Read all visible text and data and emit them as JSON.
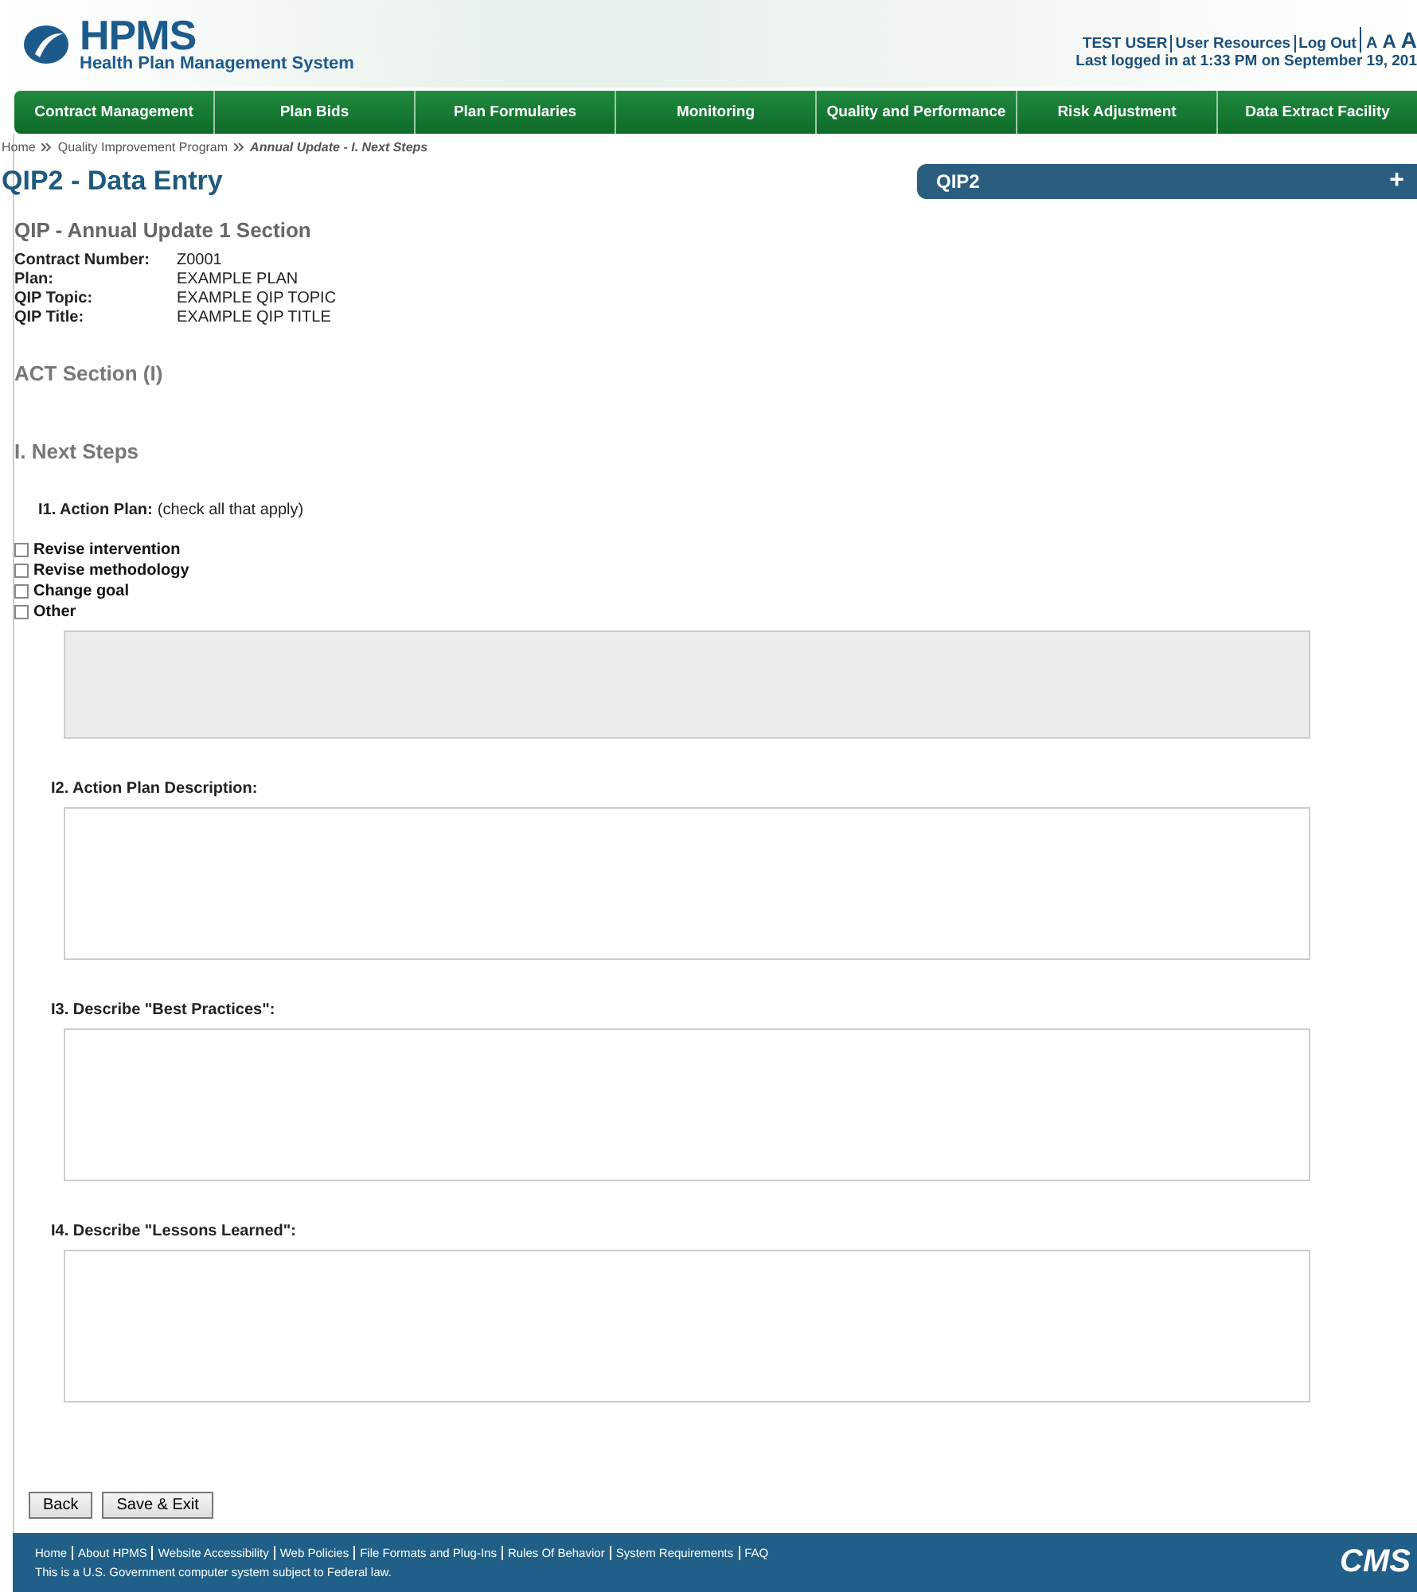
{
  "header": {
    "logo_title": "HPMS",
    "logo_subtitle": "Health Plan Management System",
    "user_links": [
      "TEST USER",
      "User Resources",
      "Log Out"
    ],
    "font_sizes": [
      "A",
      "A",
      "A"
    ],
    "last_login": "Last logged in at 1:33 PM on September 19, 201"
  },
  "nav": [
    "Contract Management",
    "Plan Bids",
    "Plan Formularies",
    "Monitoring",
    "Quality and Performance",
    "Risk Adjustment",
    "Data Extract Facility"
  ],
  "breadcrumb": [
    {
      "label": "Home",
      "current": false
    },
    {
      "label": "Quality Improvement Program",
      "current": false
    },
    {
      "label": "Annual Update - I. Next Steps",
      "current": true
    }
  ],
  "page_title": "QIP2 - Data Entry",
  "side_panel": {
    "title": "QIP2",
    "toggle": "+"
  },
  "section_title": "QIP - Annual Update 1 Section",
  "details": [
    {
      "label": "Contract Number:",
      "value": "Z0001"
    },
    {
      "label": "Plan:",
      "value": "EXAMPLE PLAN"
    },
    {
      "label": "QIP Topic:",
      "value": "EXAMPLE QIP TOPIC"
    },
    {
      "label": "QIP Title:",
      "value": "EXAMPLE QIP TITLE"
    }
  ],
  "act_heading": "ACT Section (I)",
  "steps_heading": "I. Next Steps",
  "action_plan": {
    "label": "I1. Action Plan:",
    "hint": "(check all that apply)",
    "options": [
      {
        "label": "Revise intervention",
        "checked": false
      },
      {
        "label": "Revise methodology",
        "checked": false
      },
      {
        "label": "Change goal",
        "checked": false
      },
      {
        "label": "Other",
        "checked": false
      }
    ],
    "other_disabled": true
  },
  "questions": [
    {
      "label": "I2. Action Plan Description:"
    },
    {
      "label": "I3. Describe \"Best Practices\":"
    },
    {
      "label": "I4. Describe \"Lessons Learned\":"
    }
  ],
  "buttons": [
    "Back",
    "Save & Exit"
  ],
  "footer": {
    "links": [
      "Home",
      "About HPMS",
      "Website Accessibility",
      "Web Policies",
      "File Formats and Plug-Ins",
      "Rules Of Behavior",
      "System Requirements",
      "FAQ"
    ],
    "notice": "This is a U.S. Government computer system subject to Federal law.",
    "logo": "CMS"
  }
}
